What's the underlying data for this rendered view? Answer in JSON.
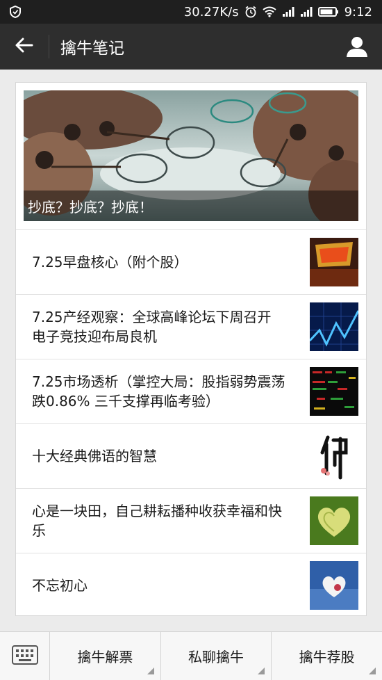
{
  "status_bar": {
    "speed": "30.27K/s",
    "time": "9:12",
    "icons": [
      "shield-icon",
      "alarm-icon",
      "wifi-icon",
      "signal-icon",
      "signal-icon",
      "battery-icon"
    ]
  },
  "header": {
    "title": "擒牛笔记",
    "back_icon": "back-arrow-icon",
    "profile_icon": "person-icon"
  },
  "cover_article": {
    "caption": "抄底？抄底？抄底！"
  },
  "articles": [
    {
      "title": "7.25早盘核心（附个股）",
      "thumb": "limit-up-thumbnail"
    },
    {
      "title": "7.25产经观察：全球高峰论坛下周召开 电子竞技迎布局良机",
      "thumb": "stock-chart-thumbnail"
    },
    {
      "title": "7.25市场透析（掌控大局：股指弱势震荡跌0.86% 三千支撑再临考验）",
      "thumb": "stock-board-thumbnail"
    },
    {
      "title": "十大经典佛语的智慧",
      "thumb": "buddha-calligraphy-thumbnail"
    },
    {
      "title": "心是一块田，自己耕耘播种收获幸福和快乐",
      "thumb": "heart-field-thumbnail"
    },
    {
      "title": "不忘初心",
      "thumb": "heart-sky-thumbnail"
    }
  ],
  "bottom_menu": {
    "keyboard_icon": "keyboard-icon",
    "items": [
      {
        "label": "擒牛解票"
      },
      {
        "label": "私聊擒牛"
      },
      {
        "label": "擒牛荐股"
      }
    ]
  },
  "colors": {
    "status_bar_bg": "#1f1f1f",
    "header_bg": "#2e2e2e",
    "page_bg": "#ebebeb"
  }
}
